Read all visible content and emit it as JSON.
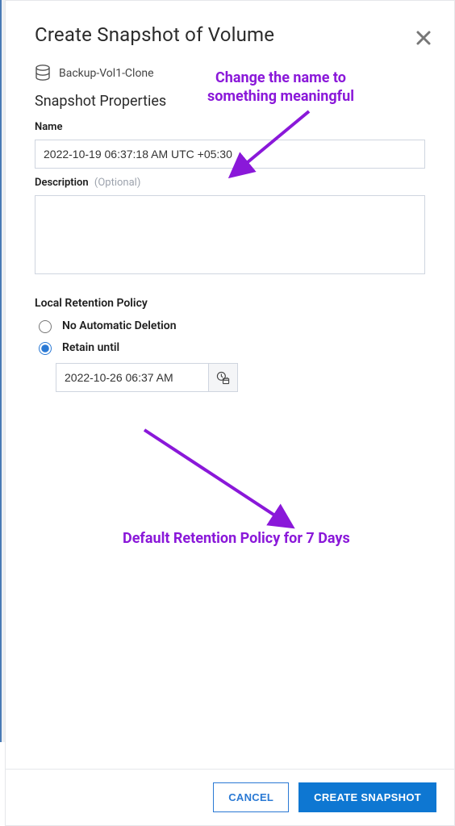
{
  "header": {
    "title": "Create Snapshot of Volume"
  },
  "volume": {
    "name": "Backup-Vol1-Clone"
  },
  "section": {
    "properties_heading": "Snapshot Properties",
    "name_label": "Name",
    "name_value": "2022-10-19 06:37:18 AM UTC +05:30",
    "description_label": "Description",
    "description_optional": "(Optional)",
    "description_value": ""
  },
  "retention": {
    "heading": "Local Retention Policy",
    "no_deletion_label": "No Automatic Deletion",
    "retain_until_label": "Retain until",
    "selected": "retain_until",
    "retain_until_value": "2022-10-26 06:37 AM"
  },
  "footer": {
    "cancel_label": "CANCEL",
    "create_label": "CREATE SNAPSHOT"
  },
  "annotations": {
    "a1_line1": "Change the name to",
    "a1_line2": "something meaningful",
    "a2": "Default Retention Policy for 7 Days"
  },
  "icons": {
    "volume": "database-icon",
    "close": "close-icon",
    "datetime": "clock-calendar-icon"
  }
}
